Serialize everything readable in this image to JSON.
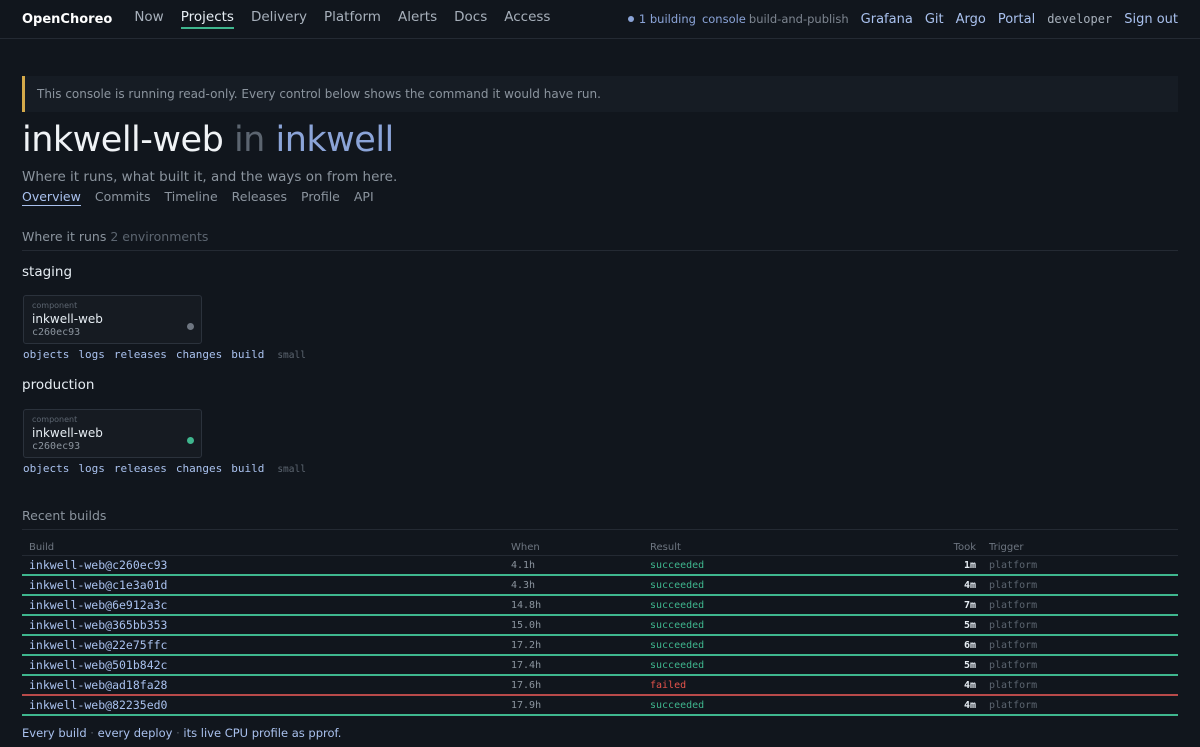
{
  "nav": {
    "brand": "OpenChoreo",
    "links": [
      "Now",
      "Projects",
      "Delivery",
      "Platform",
      "Alerts",
      "Docs",
      "Access"
    ],
    "active": "Projects",
    "building": "1 building",
    "console_label": "console",
    "pipeline": "build-and-publish",
    "right_links": [
      "Grafana",
      "Git",
      "Argo",
      "Portal"
    ],
    "user": "developer",
    "signout": "Sign out"
  },
  "banner": "This console is running read-only. Every control below shows the command it would have run.",
  "page": {
    "component": "inkwell-web",
    "in": "in",
    "project": "inkwell",
    "subtitle": "Where it runs, what built it, and the ways on from here.",
    "tabs": [
      "Overview",
      "Commits",
      "Timeline",
      "Releases",
      "Profile",
      "API"
    ],
    "active_tab": "Overview"
  },
  "runs": {
    "heading": "Where it runs",
    "count": "2 environments",
    "environments": [
      {
        "name": "staging",
        "kind": "component",
        "component": "inkwell-web",
        "commit": "c260ec93",
        "status_color": "#6e7681",
        "actions": [
          "objects",
          "logs",
          "releases",
          "changes",
          "build"
        ],
        "size": "small"
      },
      {
        "name": "production",
        "kind": "component",
        "component": "inkwell-web",
        "commit": "c260ec93",
        "status_color": "#3fb68e",
        "actions": [
          "objects",
          "logs",
          "releases",
          "changes",
          "build"
        ],
        "size": "small"
      }
    ]
  },
  "builds": {
    "heading": "Recent builds",
    "columns": [
      "Build",
      "When",
      "Result",
      "Took",
      "Trigger"
    ],
    "rows": [
      {
        "build": "inkwell-web@c260ec93",
        "when": "4.1h",
        "result": "succeeded",
        "took": "1m",
        "trigger": "platform"
      },
      {
        "build": "inkwell-web@c1e3a01d",
        "when": "4.3h",
        "result": "succeeded",
        "took": "4m",
        "trigger": "platform"
      },
      {
        "build": "inkwell-web@6e912a3c",
        "when": "14.8h",
        "result": "succeeded",
        "took": "7m",
        "trigger": "platform"
      },
      {
        "build": "inkwell-web@365bb353",
        "when": "15.0h",
        "result": "succeeded",
        "took": "5m",
        "trigger": "platform"
      },
      {
        "build": "inkwell-web@22e75ffc",
        "when": "17.2h",
        "result": "succeeded",
        "took": "6m",
        "trigger": "platform"
      },
      {
        "build": "inkwell-web@501b842c",
        "when": "17.4h",
        "result": "succeeded",
        "took": "5m",
        "trigger": "platform"
      },
      {
        "build": "inkwell-web@ad18fa28",
        "when": "17.6h",
        "result": "failed",
        "took": "4m",
        "trigger": "platform"
      },
      {
        "build": "inkwell-web@82235ed0",
        "when": "17.9h",
        "result": "succeeded",
        "took": "4m",
        "trigger": "platform"
      }
    ]
  },
  "footer": {
    "items": [
      "Every build",
      "every deploy",
      "its live CPU profile as pprof."
    ],
    "separator": "·"
  }
}
